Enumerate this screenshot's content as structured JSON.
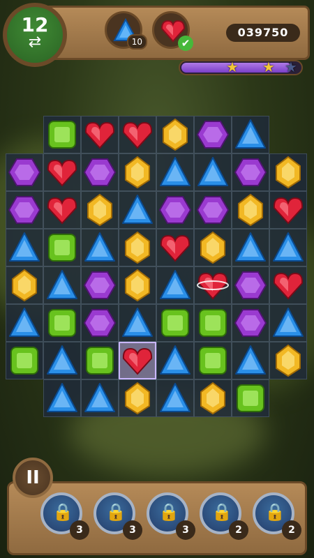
{
  "hud": {
    "moves": "12",
    "swap_icon": "⇄",
    "goals": [
      {
        "gem": "blue",
        "count": "10"
      },
      {
        "gem": "red",
        "completed": true,
        "check": "✔"
      }
    ],
    "score": "039750",
    "progress": 0.93,
    "stars_earned": 2
  },
  "board": {
    "rows": [
      [
        "",
        "green",
        "red",
        "red",
        "yellow",
        "purple",
        "blue",
        ""
      ],
      [
        "purple",
        "red",
        "purple",
        "yellow",
        "blue",
        "blue",
        "purple",
        "yellow"
      ],
      [
        "purple",
        "red",
        "yellow",
        "blue",
        "purple",
        "purple",
        "yellow",
        "red"
      ],
      [
        "blue",
        "green",
        "blue",
        "yellow",
        "red",
        "yellow",
        "blue",
        "blue"
      ],
      [
        "yellow",
        "blue",
        "purple",
        "yellow",
        "blue",
        "red-striped",
        "purple",
        "red"
      ],
      [
        "blue",
        "green",
        "purple",
        "blue",
        "green",
        "green",
        "purple",
        "blue"
      ],
      [
        "green",
        "blue",
        "green",
        "red-selected",
        "blue",
        "green",
        "blue",
        "yellow"
      ],
      [
        "",
        "blue",
        "blue",
        "yellow",
        "blue",
        "yellow",
        "green",
        ""
      ]
    ]
  },
  "controls": {
    "pause_icon": "pause-icon",
    "pause_label": "II"
  },
  "boosters": [
    {
      "count": "3",
      "locked": true
    },
    {
      "count": "3",
      "locked": true
    },
    {
      "count": "3",
      "locked": true
    },
    {
      "count": "2",
      "locked": true
    },
    {
      "count": "2",
      "locked": true
    }
  ],
  "colors": {
    "red": "#e0243a",
    "blue": "#2a8fe8",
    "yellow": "#f2b824",
    "purple": "#9a3ad0",
    "green": "#68c21e"
  }
}
